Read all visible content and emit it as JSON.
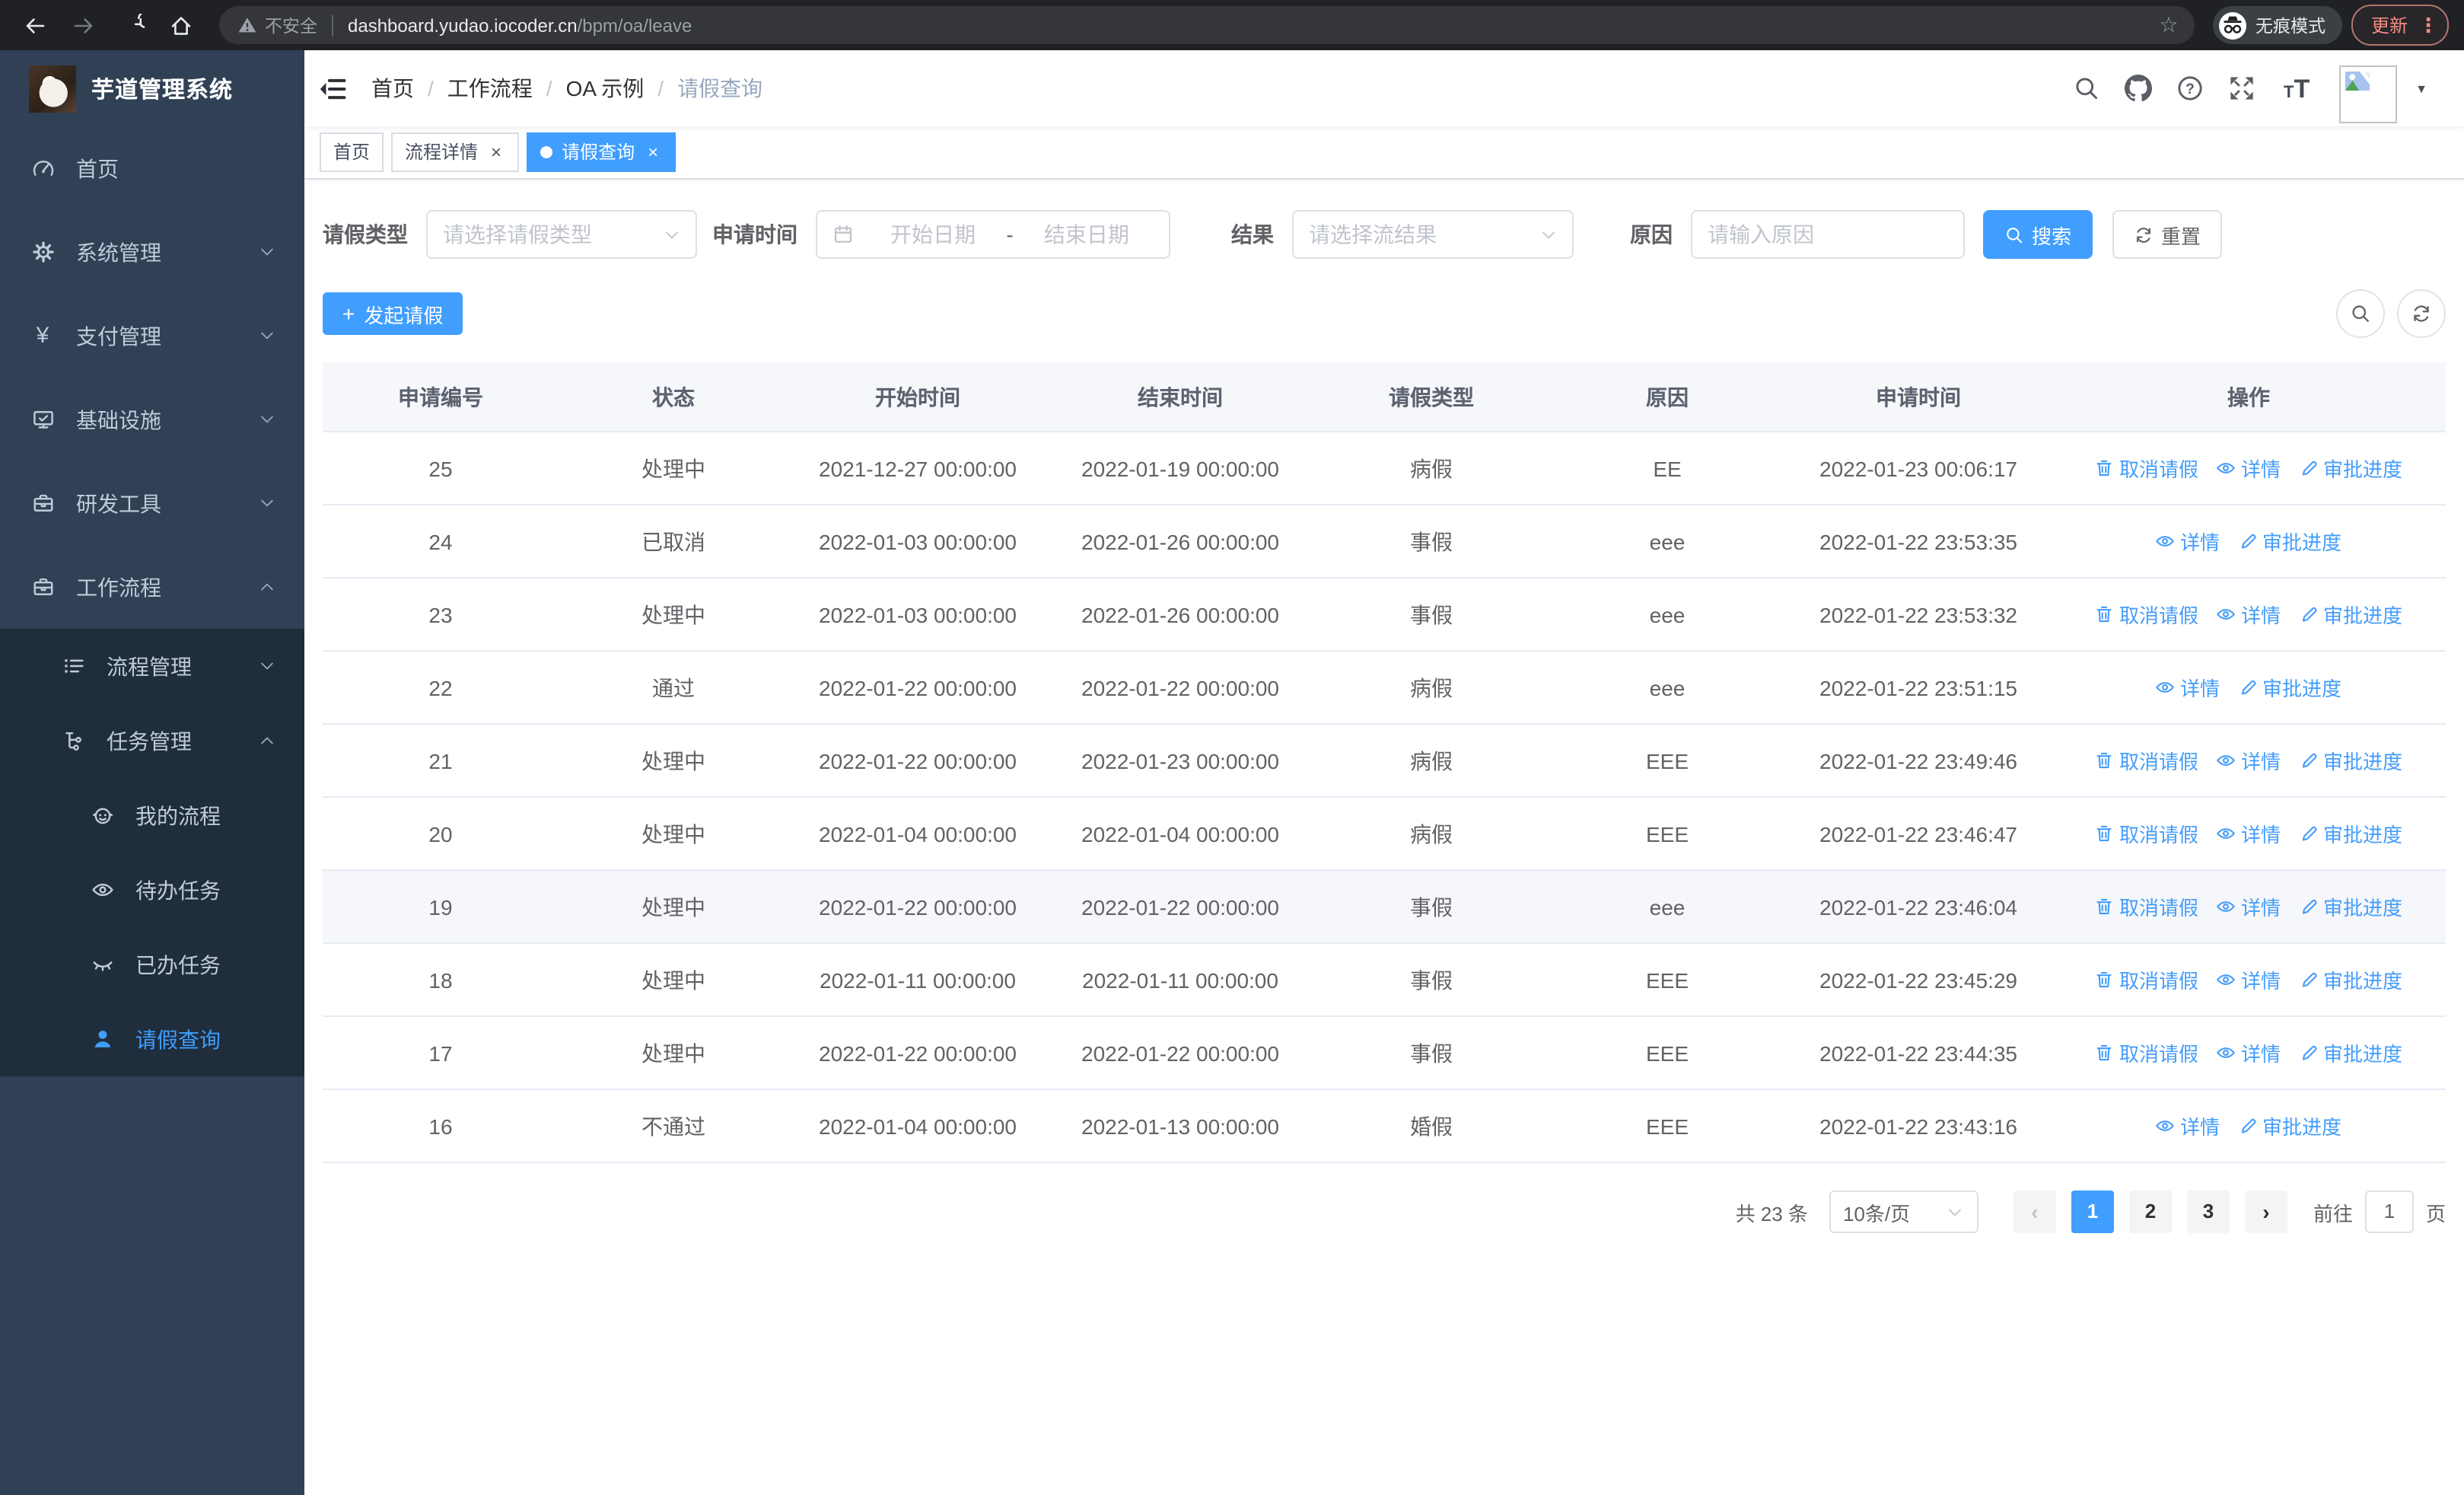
{
  "browser": {
    "security_label": "不安全",
    "url_host": "dashboard.yudao.iocoder.cn",
    "url_path": "/bpm/oa/leave",
    "incognito_label": "无痕模式",
    "update_label": "更新",
    "menu_dots": "⋮",
    "nav_icons": [
      "back-arrow",
      "forward-arrow",
      "reload",
      "home",
      "warning",
      "bookmark-star",
      "incognito"
    ]
  },
  "sidebar": {
    "title": "芋道管理系统",
    "items": [
      {
        "slug": "home",
        "label": "首页",
        "icon": "gauge",
        "level": 1,
        "submenu": false,
        "chevron": null,
        "active": false
      },
      {
        "slug": "system-management",
        "label": "系统管理",
        "icon": "gear",
        "level": 1,
        "submenu": false,
        "chevron": "down",
        "active": false
      },
      {
        "slug": "payment-management",
        "label": "支付管理",
        "icon": "yen",
        "level": 1,
        "submenu": false,
        "chevron": "down",
        "active": false
      },
      {
        "slug": "infrastructure",
        "label": "基础设施",
        "icon": "monitor",
        "level": 1,
        "submenu": false,
        "chevron": "down",
        "active": false
      },
      {
        "slug": "dev-tools",
        "label": "研发工具",
        "icon": "toolbox",
        "level": 1,
        "submenu": false,
        "chevron": "down",
        "active": false
      },
      {
        "slug": "workflow",
        "label": "工作流程",
        "icon": "toolbox",
        "level": 1,
        "submenu": false,
        "chevron": "up",
        "active": false
      },
      {
        "slug": "process-management",
        "label": "流程管理",
        "icon": "list",
        "level": 2,
        "submenu": true,
        "chevron": "down",
        "active": false
      },
      {
        "slug": "task-management",
        "label": "任务管理",
        "icon": "tree",
        "level": 2,
        "submenu": true,
        "chevron": "up",
        "active": false
      },
      {
        "slug": "my-processes",
        "label": "我的流程",
        "icon": "robot",
        "level": 3,
        "submenu": true,
        "chevron": null,
        "active": false
      },
      {
        "slug": "todo-tasks",
        "label": "待办任务",
        "icon": "eye-open",
        "level": 3,
        "submenu": true,
        "chevron": null,
        "active": false
      },
      {
        "slug": "done-tasks",
        "label": "已办任务",
        "icon": "eye-closed",
        "level": 3,
        "submenu": true,
        "chevron": null,
        "active": false
      },
      {
        "slug": "leave-query",
        "label": "请假查询",
        "icon": "user",
        "level": 3,
        "submenu": true,
        "chevron": null,
        "active": true
      }
    ]
  },
  "header": {
    "breadcrumb": [
      "首页",
      "工作流程",
      "OA 示例",
      "请假查询"
    ],
    "tool_icons": [
      "search",
      "github",
      "question",
      "fullscreen",
      "font-size",
      "avatar",
      "caret-down"
    ],
    "font_size_small": "T",
    "font_size_big": "T",
    "caret": "▼"
  },
  "tabs": [
    {
      "slug": "home",
      "label": "首页",
      "closable": false,
      "active": false
    },
    {
      "slug": "process-detail",
      "label": "流程详情",
      "closable": true,
      "active": false
    },
    {
      "slug": "leave-query",
      "label": "请假查询",
      "closable": true,
      "active": true
    }
  ],
  "filters": {
    "leave_type": {
      "label": "请假类型",
      "placeholder": "请选择请假类型"
    },
    "apply_time": {
      "label": "申请时间",
      "start_placeholder": "开始日期",
      "separator": "-",
      "end_placeholder": "结束日期"
    },
    "result": {
      "label": "结果",
      "placeholder": "请选择流结果"
    },
    "reason": {
      "label": "原因",
      "placeholder": "请输入原因"
    },
    "search_label": "搜索",
    "reset_label": "重置"
  },
  "toolbar": {
    "create_label": "发起请假",
    "plus_glyph": "+",
    "icon_buttons": [
      "search",
      "refresh"
    ]
  },
  "table": {
    "headers": [
      "申请编号",
      "状态",
      "开始时间",
      "结束时间",
      "请假类型",
      "原因",
      "申请时间",
      "操作"
    ],
    "actions_def": {
      "cancel": {
        "label": "取消请假",
        "icon": "trash",
        "name": "cancel-leave-link"
      },
      "detail": {
        "label": "详情",
        "icon": "eye",
        "name": "detail-link"
      },
      "progress": {
        "label": "审批进度",
        "icon": "edit",
        "name": "approval-progress-link"
      }
    },
    "rows": [
      {
        "id": "25",
        "status": "处理中",
        "start": "2021-12-27 00:00:00",
        "end": "2022-01-19 00:00:00",
        "type": "病假",
        "reason": "EE",
        "applied": "2022-01-23 00:06:17",
        "actions": [
          "cancel",
          "detail",
          "progress"
        ],
        "highlight": false
      },
      {
        "id": "24",
        "status": "已取消",
        "start": "2022-01-03 00:00:00",
        "end": "2022-01-26 00:00:00",
        "type": "事假",
        "reason": "eee",
        "applied": "2022-01-22 23:53:35",
        "actions": [
          "detail",
          "progress"
        ],
        "highlight": false
      },
      {
        "id": "23",
        "status": "处理中",
        "start": "2022-01-03 00:00:00",
        "end": "2022-01-26 00:00:00",
        "type": "事假",
        "reason": "eee",
        "applied": "2022-01-22 23:53:32",
        "actions": [
          "cancel",
          "detail",
          "progress"
        ],
        "highlight": false
      },
      {
        "id": "22",
        "status": "通过",
        "start": "2022-01-22 00:00:00",
        "end": "2022-01-22 00:00:00",
        "type": "病假",
        "reason": "eee",
        "applied": "2022-01-22 23:51:15",
        "actions": [
          "detail",
          "progress"
        ],
        "highlight": false
      },
      {
        "id": "21",
        "status": "处理中",
        "start": "2022-01-22 00:00:00",
        "end": "2022-01-23 00:00:00",
        "type": "病假",
        "reason": "EEE",
        "applied": "2022-01-22 23:49:46",
        "actions": [
          "cancel",
          "detail",
          "progress"
        ],
        "highlight": false
      },
      {
        "id": "20",
        "status": "处理中",
        "start": "2022-01-04 00:00:00",
        "end": "2022-01-04 00:00:00",
        "type": "病假",
        "reason": "EEE",
        "applied": "2022-01-22 23:46:47",
        "actions": [
          "cancel",
          "detail",
          "progress"
        ],
        "highlight": false
      },
      {
        "id": "19",
        "status": "处理中",
        "start": "2022-01-22 00:00:00",
        "end": "2022-01-22 00:00:00",
        "type": "事假",
        "reason": "eee",
        "applied": "2022-01-22 23:46:04",
        "actions": [
          "cancel",
          "detail",
          "progress"
        ],
        "highlight": true
      },
      {
        "id": "18",
        "status": "处理中",
        "start": "2022-01-11 00:00:00",
        "end": "2022-01-11 00:00:00",
        "type": "事假",
        "reason": "EEE",
        "applied": "2022-01-22 23:45:29",
        "actions": [
          "cancel",
          "detail",
          "progress"
        ],
        "highlight": false
      },
      {
        "id": "17",
        "status": "处理中",
        "start": "2022-01-22 00:00:00",
        "end": "2022-01-22 00:00:00",
        "type": "事假",
        "reason": "EEE",
        "applied": "2022-01-22 23:44:35",
        "actions": [
          "cancel",
          "detail",
          "progress"
        ],
        "highlight": false
      },
      {
        "id": "16",
        "status": "不通过",
        "start": "2022-01-04 00:00:00",
        "end": "2022-01-13 00:00:00",
        "type": "婚假",
        "reason": "EEE",
        "applied": "2022-01-22 23:43:16",
        "actions": [
          "detail",
          "progress"
        ],
        "highlight": false
      }
    ]
  },
  "pagination": {
    "total_label": "共 23 条",
    "page_size": "10条/页",
    "prev_glyph": "‹",
    "next_glyph": "›",
    "pages": [
      {
        "label": "1",
        "active": true
      },
      {
        "label": "2",
        "active": false
      },
      {
        "label": "3",
        "active": false
      }
    ],
    "goto_label": "前往",
    "goto_value": "1",
    "page_label": "页"
  },
  "colors": {
    "primary": "#409eff",
    "sidebar_bg": "#304156",
    "submenu_bg": "#1f2d3d",
    "sidebar_text": "#bfcbd9",
    "chrome_bg": "#1f2125",
    "update_accent": "#f28b82",
    "table_border": "#e6ebf4",
    "header_row_bg": "#f6f7fa",
    "hover_row_bg": "#f5f7fa",
    "placeholder": "#c0c4cc"
  }
}
